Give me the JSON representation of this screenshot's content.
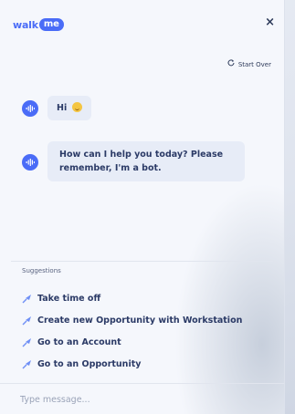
{
  "header": {
    "logo_text": "walk",
    "logo_pill": "me",
    "close_label": "×"
  },
  "chat": {
    "start_over_label": "Start Over",
    "messages": [
      {
        "text": "Hi"
      },
      {
        "text": "How can I help you today? Please remember, I'm a bot."
      }
    ]
  },
  "suggestions": {
    "title": "Suggestions",
    "items": [
      {
        "label": "Take time off"
      },
      {
        "label": "Create new Opportunity with Workstation"
      },
      {
        "label": "Go to an Account"
      },
      {
        "label": "Go to an Opportunity"
      }
    ]
  },
  "input": {
    "placeholder": "Type message..."
  },
  "colors": {
    "accent": "#4a6cf7",
    "text": "#2b3a66",
    "bubble": "#e7ecf7"
  }
}
